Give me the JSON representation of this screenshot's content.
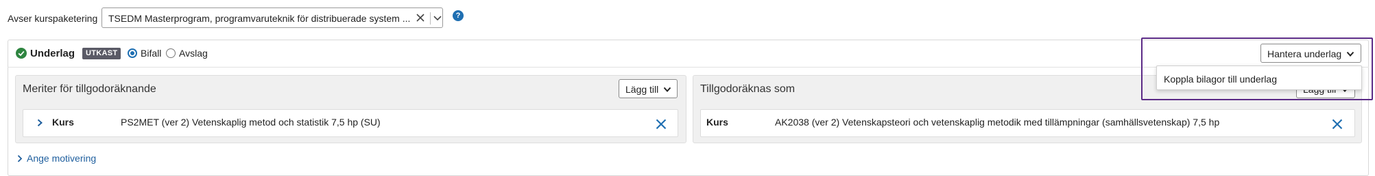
{
  "kurspaketering": {
    "label": "Avser kurspaketering",
    "selected": "TSEDM Masterprogram, programvaruteknik för distribuerade system ..."
  },
  "underlag": {
    "title": "Underlag",
    "status_badge": "UTKAST",
    "decision_options": [
      "Bifall",
      "Avslag"
    ],
    "selected_decision": "Bifall",
    "manage_button": "Hantera underlag",
    "manage_menu_items": [
      "Koppla bilagor till underlag"
    ]
  },
  "meriter": {
    "title": "Meriter för tillgodoräknande",
    "add_button": "Lägg till",
    "rows": [
      {
        "type": "Kurs",
        "name": "PS2MET (ver 2) Vetenskaplig metod och statistik 7,5 hp (SU)"
      }
    ]
  },
  "tillgodoraknas": {
    "title": "Tillgodoräknas som",
    "add_button": "Lägg till",
    "rows": [
      {
        "type": "Kurs",
        "name": "AK2038 (ver 2) Vetenskapsteori och vetenskaplig metodik med tillämpningar (samhällsvetenskap) 7,5 hp"
      }
    ]
  },
  "motivering_link": "Ange motivering",
  "colors": {
    "accent_blue": "#1f6fb2",
    "link_blue": "#1f5f9e",
    "success_green": "#2e8540",
    "badge_gray": "#5a5a66",
    "highlight_purple": "#5b2a86"
  },
  "icons": {
    "help": "question-circle-icon",
    "status": "check-circle-icon",
    "remove": "close-icon",
    "expand": "chevron-right-icon",
    "dropdown": "chevron-down-icon"
  }
}
